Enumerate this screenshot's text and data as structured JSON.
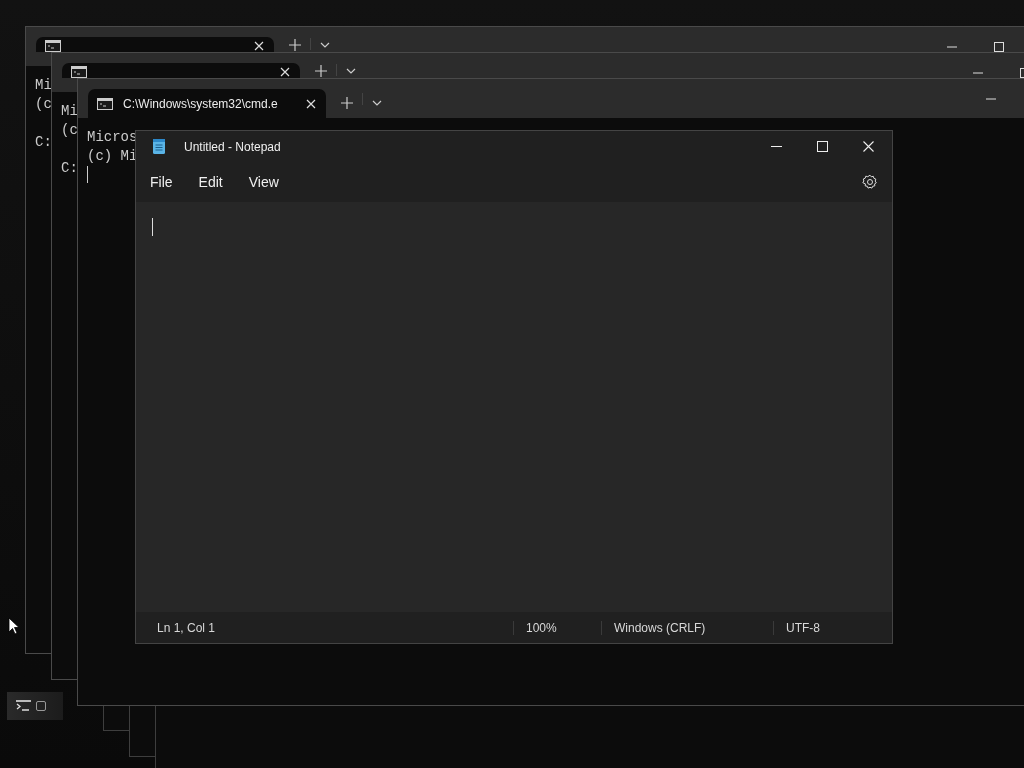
{
  "terminals": [
    {
      "tab": {
        "selected": true
      },
      "lines": [
        "Mi",
        "(c"
      ],
      "prompt": "C:",
      "cursor": false
    },
    {
      "tab": {
        "selected": true
      },
      "lines": [
        "Mi",
        "(c"
      ],
      "prompt": "C:",
      "cursor": false
    },
    {
      "tab": {
        "title": "C:\\Windows\\system32\\cmd.e",
        "selected": true
      },
      "lines": [
        "Micros",
        "(c) Mi"
      ],
      "cursor": true
    }
  ],
  "notepad": {
    "title": "Untitled - Notepad",
    "menu": [
      "File",
      "Edit",
      "View"
    ],
    "status": [
      "Ln 1, Col 1",
      "100%",
      "Windows (CRLF)",
      "UTF-8"
    ]
  }
}
